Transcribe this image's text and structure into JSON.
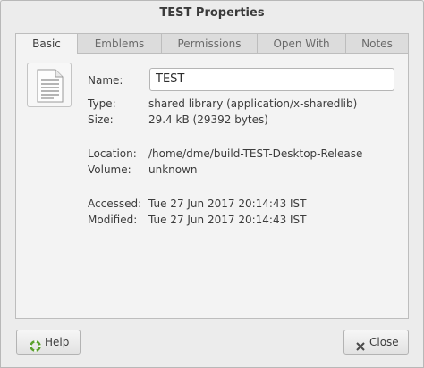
{
  "window": {
    "title": "TEST Properties"
  },
  "tabs": [
    {
      "label": "Basic",
      "active": true
    },
    {
      "label": "Emblems",
      "active": false
    },
    {
      "label": "Permissions",
      "active": false
    },
    {
      "label": "Open With",
      "active": false
    },
    {
      "label": "Notes",
      "active": false
    }
  ],
  "basic": {
    "file_icon": "text-document-icon",
    "name": {
      "label": "Name:",
      "value": "TEST"
    },
    "type": {
      "label": "Type:",
      "value": "shared library (application/x-sharedlib)"
    },
    "size": {
      "label": "Size:",
      "value": "29.4 kB (29392 bytes)"
    },
    "location": {
      "label": "Location:",
      "value": "/home/dme/build-TEST-Desktop-Release"
    },
    "volume": {
      "label": "Volume:",
      "value": "unknown"
    },
    "accessed": {
      "label": "Accessed:",
      "value": "Tue 27 Jun 2017 20:14:43 IST"
    },
    "modified": {
      "label": "Modified:",
      "value": "Tue 27 Jun 2017 20:14:43 IST"
    }
  },
  "buttons": {
    "help": {
      "label": "Help",
      "icon": "lifebuoy-icon"
    },
    "close": {
      "label": "Close",
      "icon": "close-icon"
    }
  },
  "colors": {
    "window_bg": "#ececec",
    "panel_bg": "#f3f3f3",
    "help_icon": "#5aa02c"
  }
}
